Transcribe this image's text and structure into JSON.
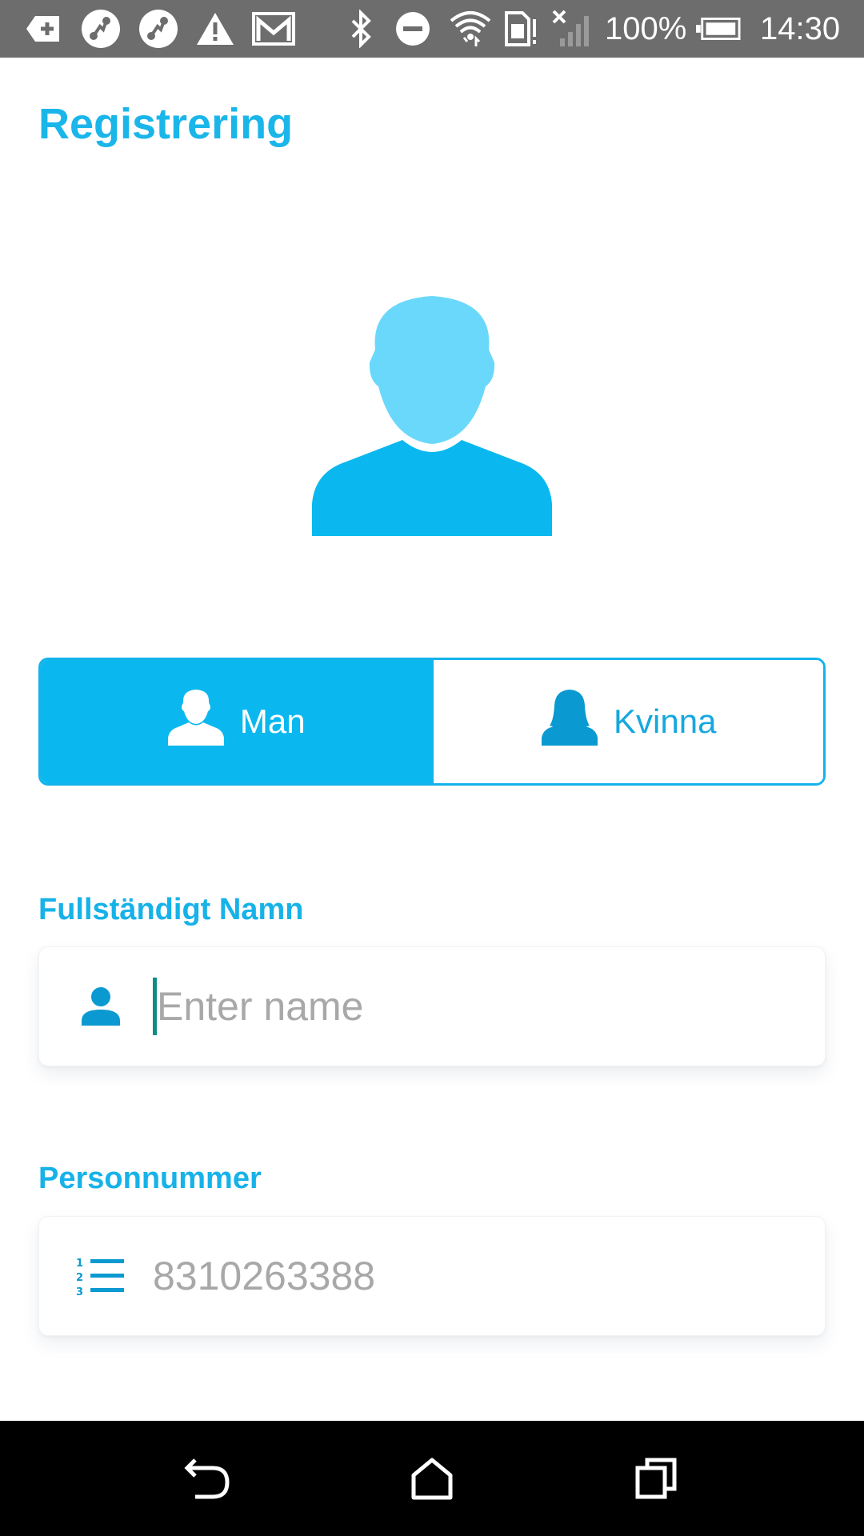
{
  "status_bar": {
    "battery_percent": "100%",
    "time": "14:30",
    "icons": [
      "usb-plus-icon",
      "route-icon",
      "route-icon",
      "warning-icon",
      "gmail-icon",
      "bluetooth-icon",
      "do-not-disturb-icon",
      "wifi-icon",
      "sim-icon",
      "no-signal-icon",
      "battery-icon"
    ]
  },
  "page": {
    "title": "Registrering"
  },
  "gender": {
    "options": [
      {
        "label": "Man",
        "selected": true,
        "icon": "male-user-icon"
      },
      {
        "label": "Kvinna",
        "selected": false,
        "icon": "female-user-icon"
      }
    ]
  },
  "fields": {
    "name": {
      "label": "Fullständigt Namn",
      "placeholder": "Enter name",
      "value": "",
      "icon": "person-icon"
    },
    "personnummer": {
      "label": "Personnummer",
      "placeholder": "8310263388",
      "value": "",
      "icon": "numbered-list-icon"
    }
  },
  "nav_bar": {
    "buttons": [
      "back-icon",
      "home-icon",
      "recents-icon"
    ]
  },
  "colors": {
    "accent": "#1ab6ea",
    "accent_dark": "#0a9ad1",
    "status_bar": "#6d6d6d",
    "nav_bar": "#000000"
  }
}
